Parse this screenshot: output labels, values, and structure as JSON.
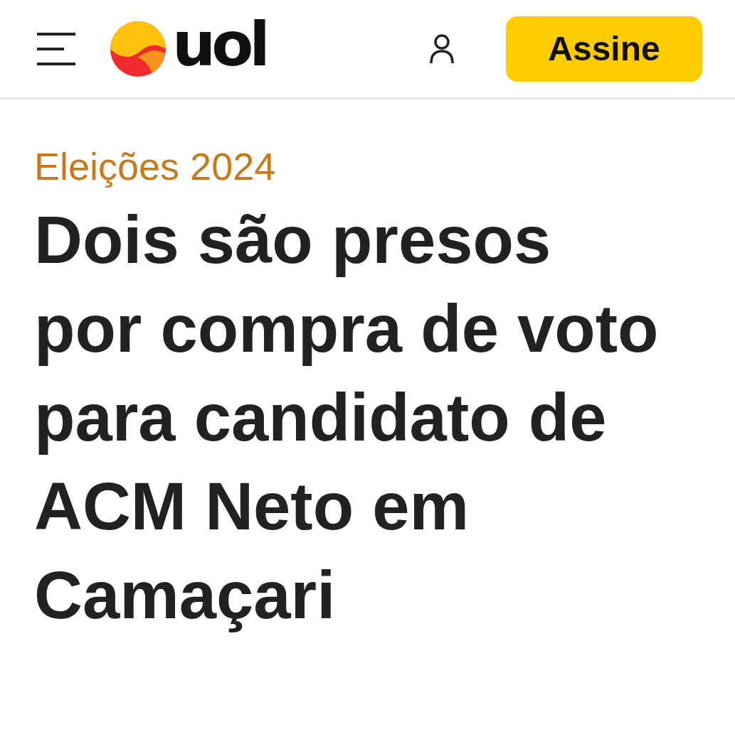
{
  "header": {
    "logo_text": "uol",
    "subscribe_button": "Assine"
  },
  "article": {
    "category": "Eleições 2024",
    "headline": "Dois são presos por compra de voto para candidato de ACM Neto em Camaçari"
  }
}
